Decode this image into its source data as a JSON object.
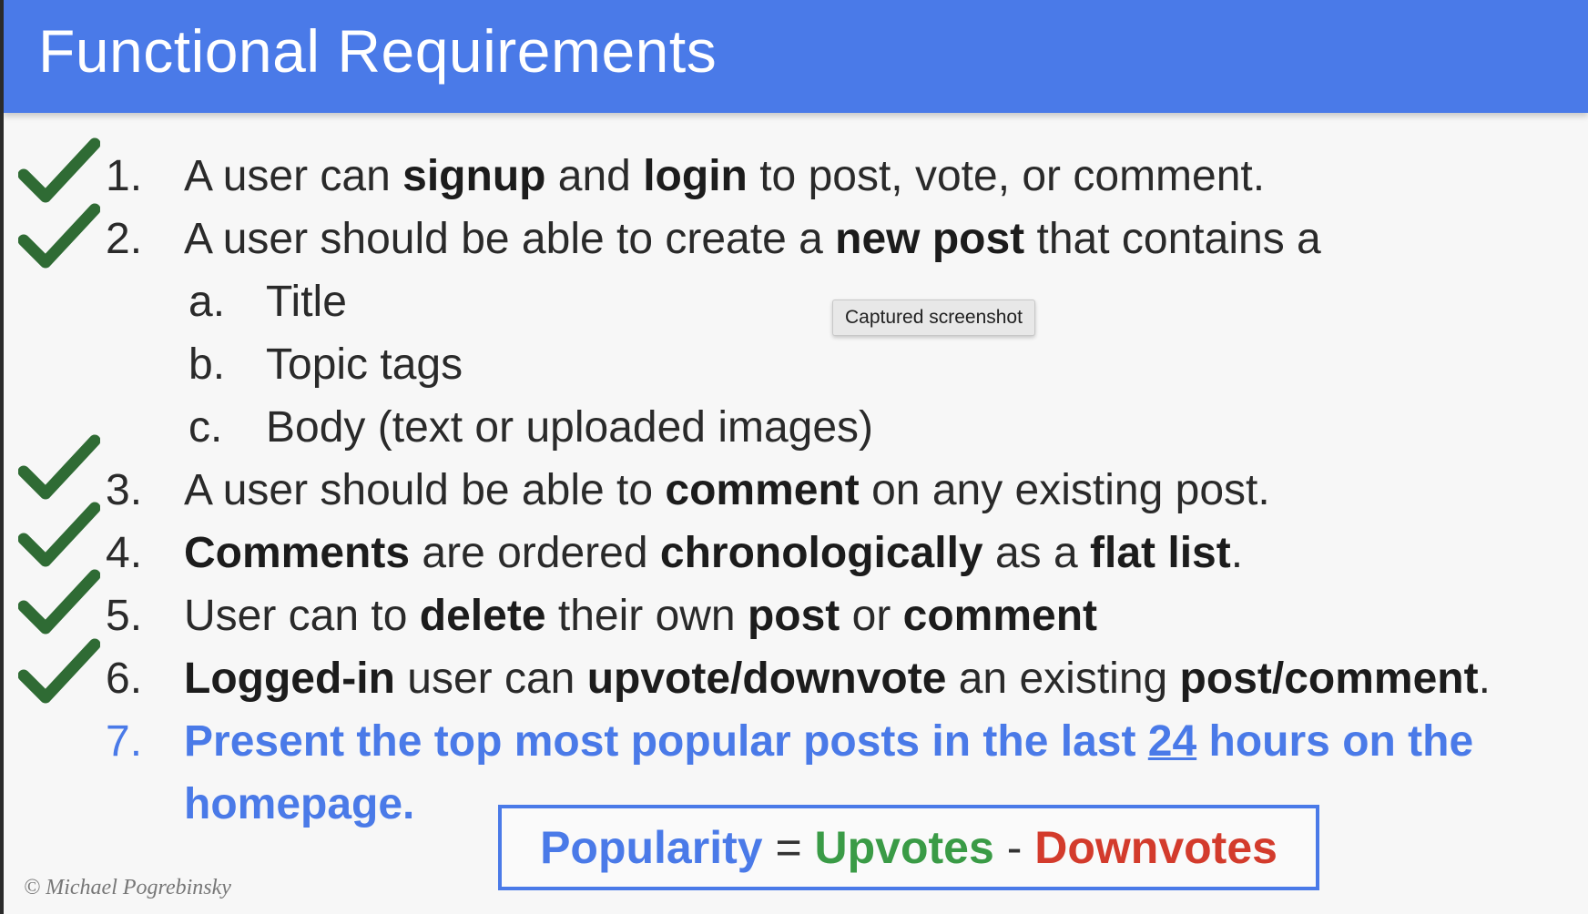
{
  "header": {
    "title": "Functional Requirements"
  },
  "items": [
    {
      "num": "1.",
      "parts": [
        [
          "A user can ",
          false
        ],
        [
          "signup",
          true
        ],
        [
          " and ",
          false
        ],
        [
          "login",
          true
        ],
        [
          " to post, vote, or comment.",
          false
        ]
      ]
    },
    {
      "num": "2.",
      "parts": [
        [
          "A user should be able to create a ",
          false
        ],
        [
          "new post",
          true
        ],
        [
          " that contains a",
          false
        ]
      ]
    },
    {
      "num": "3.",
      "parts": [
        [
          "A user should be able to ",
          false
        ],
        [
          "comment",
          true
        ],
        [
          " on any existing post.",
          false
        ]
      ]
    },
    {
      "num": "4.",
      "parts": [
        [
          "Comments",
          true
        ],
        [
          " are ordered ",
          false
        ],
        [
          "chronologically",
          true
        ],
        [
          " as a ",
          false
        ],
        [
          "flat list",
          true
        ],
        [
          ".",
          false
        ]
      ]
    },
    {
      "num": "5.",
      "parts": [
        [
          "User can to ",
          false
        ],
        [
          "delete",
          true
        ],
        [
          " their own ",
          false
        ],
        [
          "post",
          true
        ],
        [
          " or ",
          false
        ],
        [
          "comment",
          true
        ]
      ]
    },
    {
      "num": "6.",
      "parts": [
        [
          "Logged-in",
          true
        ],
        [
          " user can ",
          false
        ],
        [
          "upvote/downvote",
          true
        ],
        [
          " an existing ",
          false
        ],
        [
          "post/comment",
          true
        ],
        [
          ".",
          false
        ]
      ]
    }
  ],
  "subitems": [
    {
      "letter": "a.",
      "text": "Title"
    },
    {
      "letter": "b.",
      "text": "Topic tags"
    },
    {
      "letter": "c.",
      "text": "Body (text or uploaded images)"
    }
  ],
  "item7": {
    "num": "7.",
    "line1_before": "Present the top most popular posts in the last ",
    "line1_underlined": "24",
    "line1_after": " hours on the",
    "line2": "homepage."
  },
  "formula": {
    "popularity": "Popularity",
    "equals": " = ",
    "upvotes": "Upvotes",
    "minus": " - ",
    "downvotes": "Downvotes"
  },
  "tooltip": "Captured screenshot",
  "copyright": "© Michael Pogrebinsky",
  "colors": {
    "header": "#4a7ae8",
    "check": "#2f6b34",
    "highlight": "#4a7ae8",
    "upvotes": "#3a9b46",
    "downvotes": "#d33b2c"
  }
}
